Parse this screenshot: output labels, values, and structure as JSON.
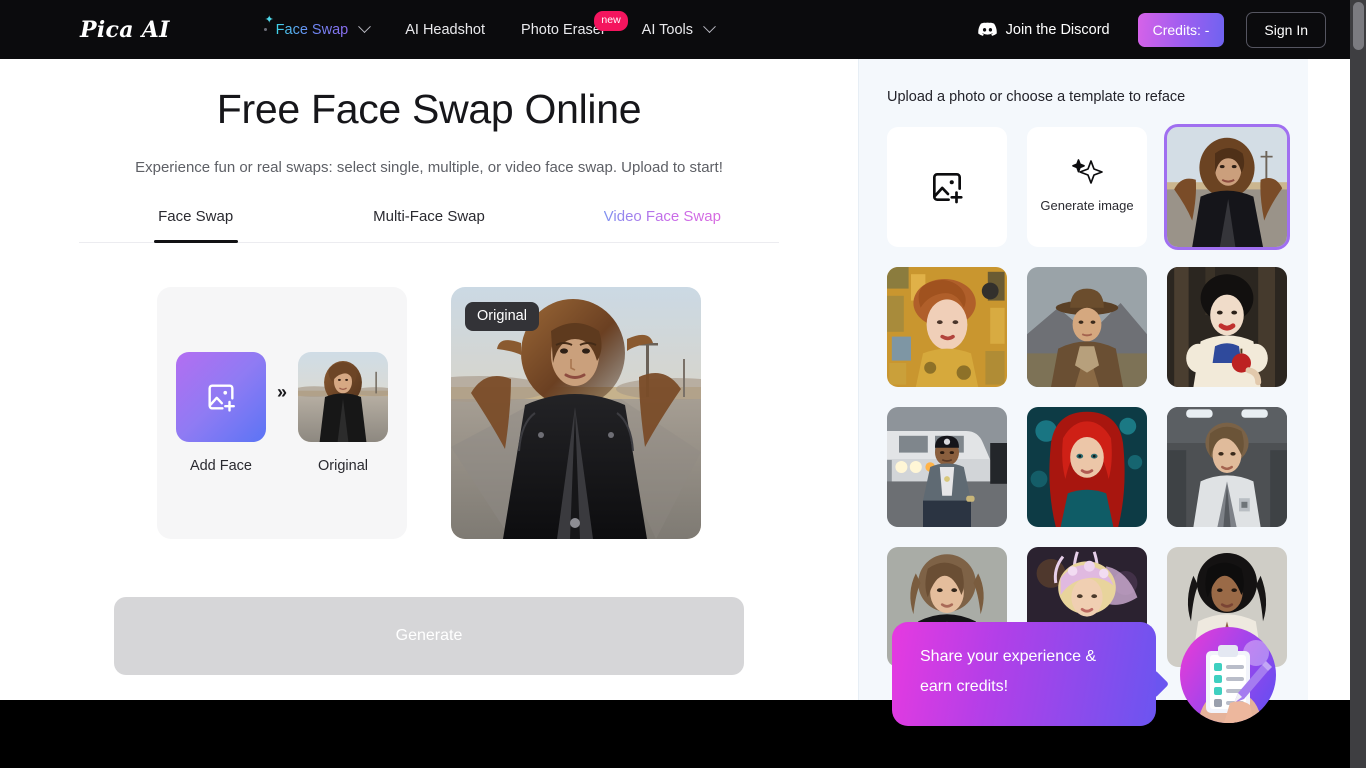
{
  "header": {
    "logo": "Pica AI",
    "nav": [
      {
        "label": "Face Swap",
        "icon": "sparkle-icon",
        "has_chevron": true,
        "gradient": true
      },
      {
        "label": "AI Headshot",
        "has_chevron": false
      },
      {
        "label": "Photo Eraser",
        "badge": "new",
        "has_chevron": false
      },
      {
        "label": "AI Tools",
        "has_chevron": true
      }
    ],
    "discord_label": "Join the Discord",
    "discord_icon": "discord-icon",
    "credits_label": "Credits: -",
    "signin_label": "Sign In",
    "colors": {
      "background": "#0b0b0d",
      "credits_gradient_from": "#d662e8",
      "credits_gradient_to": "#6f63f0",
      "badge_new": "#f4155e"
    }
  },
  "main": {
    "title": "Free Face Swap Online",
    "subtitle": "Experience fun or real swaps: select single, multiple, or video face swap. Upload to start!",
    "tabs": [
      {
        "label": "Face Swap",
        "active": true
      },
      {
        "label": "Multi-Face Swap",
        "active": false
      },
      {
        "label": "Video Face Swap",
        "active": false,
        "gradient": true
      }
    ],
    "face_card": {
      "add_face_label": "Add Face",
      "add_face_icon": "add-image-icon",
      "arrow_glyph": "»",
      "target_label": "Original",
      "target_thumb": "woman-leather-jacket-desert-road"
    },
    "preview": {
      "badge": "Original",
      "image": "woman-leather-jacket-desert-road"
    },
    "generate_label": "Generate",
    "generate_disabled": true
  },
  "panel": {
    "title": "Upload a photo or choose a template to reface",
    "cards": [
      {
        "type": "upload",
        "icon": "add-image-icon",
        "label": ""
      },
      {
        "type": "generate",
        "icon": "sparkles-icon",
        "label": "Generate image"
      },
      {
        "type": "template",
        "selected": true,
        "image": "woman-leather-jacket-desert-road"
      },
      {
        "type": "template",
        "selected": false,
        "image": "klimt-golden-portrait"
      },
      {
        "type": "template",
        "selected": false,
        "image": "cowboy-hat-man"
      },
      {
        "type": "template",
        "selected": false,
        "image": "snow-white-apple"
      },
      {
        "type": "template",
        "selected": false,
        "image": "rapper-beanie-car"
      },
      {
        "type": "template",
        "selected": false,
        "image": "red-hair-woman-neon"
      },
      {
        "type": "template",
        "selected": false,
        "image": "scifi-white-suit-woman"
      },
      {
        "type": "template",
        "selected": false,
        "image": "brunette-black-blazer"
      },
      {
        "type": "template",
        "selected": false,
        "image": "fairy-crown-blonde"
      },
      {
        "type": "template",
        "selected": false,
        "image": "woman-cream-blazer"
      }
    ],
    "selection_color": "#a06ff0",
    "background": "#f4f8fc"
  },
  "survey": {
    "message_line1": "Share your experience &",
    "message_line2": "earn credits!",
    "icon": "clipboard-survey-icon",
    "gradient_from": "#e63ae0",
    "gradient_to": "#6b55f0"
  }
}
